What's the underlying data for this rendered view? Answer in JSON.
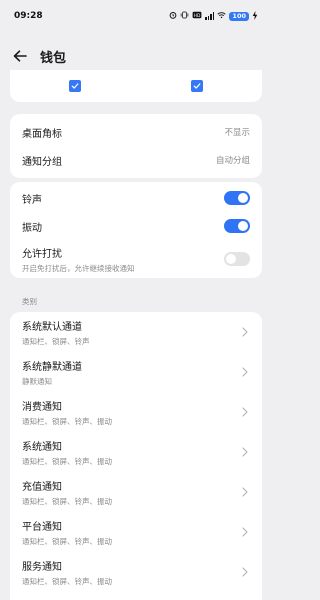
{
  "status_bar": {
    "time": "09:28",
    "battery": "100"
  },
  "header": {
    "title": "钱包"
  },
  "settings": [
    {
      "label": "桌面角标",
      "value": "不显示"
    },
    {
      "label": "通知分组",
      "value": "自动分组"
    }
  ],
  "toggles": [
    {
      "label": "铃声",
      "subtitle": "",
      "state": "on"
    },
    {
      "label": "振动",
      "subtitle": "",
      "state": "on"
    },
    {
      "label": "允许打扰",
      "subtitle": "开启免打扰后，允许继续接收通知",
      "state": "off"
    }
  ],
  "category_header": "类别",
  "channels": [
    {
      "title": "系统默认通道",
      "subtitle": "通知栏、锁屏、铃声"
    },
    {
      "title": "系统静默通道",
      "subtitle": "静默通知"
    },
    {
      "title": "消费通知",
      "subtitle": "通知栏、锁屏、铃声、振动"
    },
    {
      "title": "系统通知",
      "subtitle": "通知栏、锁屏、铃声、振动"
    },
    {
      "title": "充值通知",
      "subtitle": "通知栏、锁屏、铃声、振动"
    },
    {
      "title": "平台通知",
      "subtitle": "通知栏、锁屏、铃声、振动"
    },
    {
      "title": "服务通知",
      "subtitle": "通知栏、锁屏、铃声、振动"
    }
  ],
  "colors": {
    "accent": "#2f74f4",
    "background": "#efeff1",
    "card": "#ffffff"
  },
  "icons": {
    "back": "arrow-left-icon",
    "checkbox": "checkbox-checked-icon",
    "chevron": "chevron-right-icon"
  }
}
